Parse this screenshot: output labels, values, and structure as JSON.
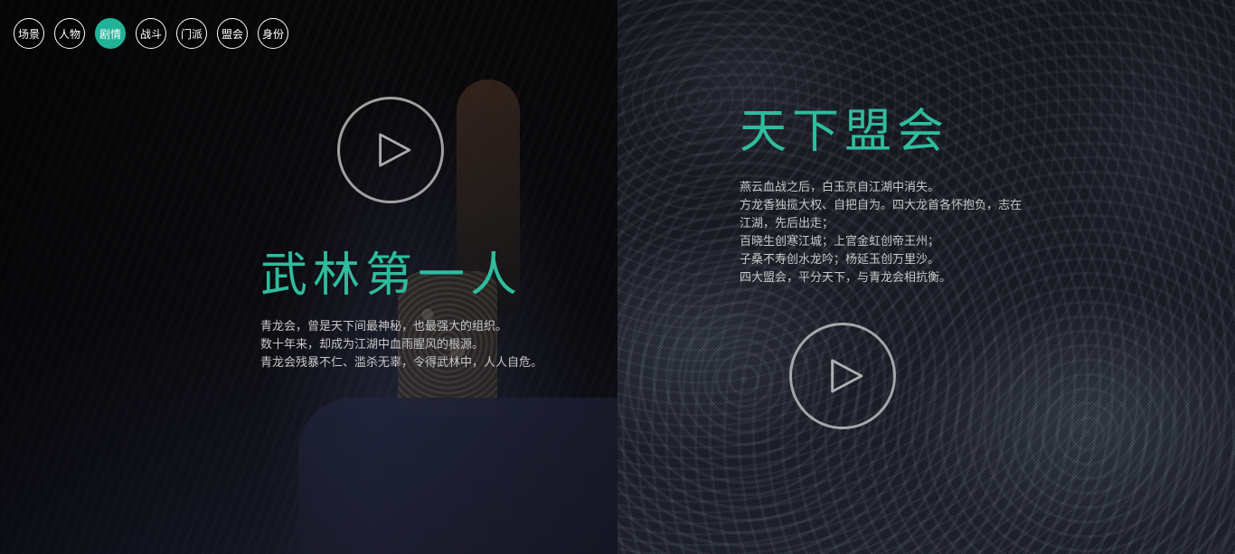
{
  "nav": {
    "items": [
      {
        "label": "场景",
        "active": false
      },
      {
        "label": "人物",
        "active": false
      },
      {
        "label": "剧情",
        "active": true
      },
      {
        "label": "战斗",
        "active": false
      },
      {
        "label": "门派",
        "active": false
      },
      {
        "label": "盟会",
        "active": false
      },
      {
        "label": "身份",
        "active": false
      }
    ]
  },
  "left": {
    "title": "武林第一人",
    "lines": [
      "青龙会，曾是天下间最神秘，也最强大的组织。",
      "数十年来，却成为江湖中血雨腥风的根源。",
      "青龙会残暴不仁、滥杀无辜，令得武林中，人人自危。"
    ]
  },
  "right": {
    "title": "天下盟会",
    "lines": [
      "燕云血战之后，白玉京自江湖中消失。",
      "方龙香独揽大权、自把自为。四大龙首各怀抱负，志在",
      "江湖，先后出走；",
      "百晓生创寒江城；上官金虹创帝王州；",
      "子桑不寿创水龙吟；杨延玉创万里沙。",
      "四大盟会，平分天下，与青龙会相抗衡。"
    ]
  },
  "colors": {
    "accent": "#21b397",
    "title": "#2fbc9d",
    "text": "#c8c8c8"
  },
  "icons": {
    "play": "play-icon"
  }
}
